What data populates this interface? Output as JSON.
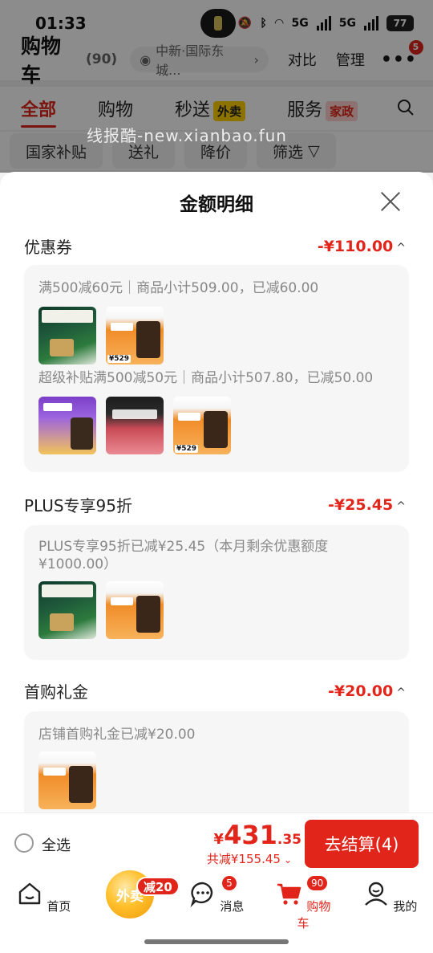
{
  "status_bar": {
    "time": "01:33",
    "net1": "5G",
    "net2": "5G",
    "battery": "77"
  },
  "header": {
    "title": "购物车",
    "count": "(90)",
    "address": "中新·国际东城...",
    "compare": "对比",
    "manage": "管理",
    "more_badge": "5"
  },
  "tabs": [
    {
      "label": "全部"
    },
    {
      "label": "购物"
    },
    {
      "label": "秒送",
      "tag": "外卖"
    },
    {
      "label": "服务",
      "tag": "家政"
    }
  ],
  "chips": [
    "国家补贴",
    "送礼",
    "降价",
    "筛选"
  ],
  "watermark": "线报酷-new.xianbao.fun",
  "sheet": {
    "title": "金额明细",
    "sections": [
      {
        "name": "优惠券",
        "amount": "-¥110.00",
        "lines": [
          "满500减60元｜商品小计509.00，已减60.00",
          "超级补贴满500减50元｜商品小计507.80，已减50.00"
        ],
        "thumb_labels": [
          "¥529",
          "¥529"
        ]
      },
      {
        "name": "PLUS专享95折",
        "amount": "-¥25.45",
        "lines": [
          "PLUS专享95折已减¥25.45（本月剩余优惠额度¥1000.00）"
        ]
      },
      {
        "name": "首购礼金",
        "amount": "-¥20.00",
        "lines": [
          "店铺首购礼金已减¥20.00"
        ]
      }
    ]
  },
  "footer": {
    "select_all": "全选",
    "currency": "¥",
    "price_int": "431",
    "price_dec": ".35",
    "reduced": "共减¥155.45",
    "checkout": "去结算(4)"
  },
  "nav": [
    {
      "label": "首页"
    },
    {
      "label": "外卖",
      "badge": "减20"
    },
    {
      "label": "消息",
      "badge": "5"
    },
    {
      "label": "购物车",
      "badge": "90"
    },
    {
      "label": "我的"
    }
  ]
}
